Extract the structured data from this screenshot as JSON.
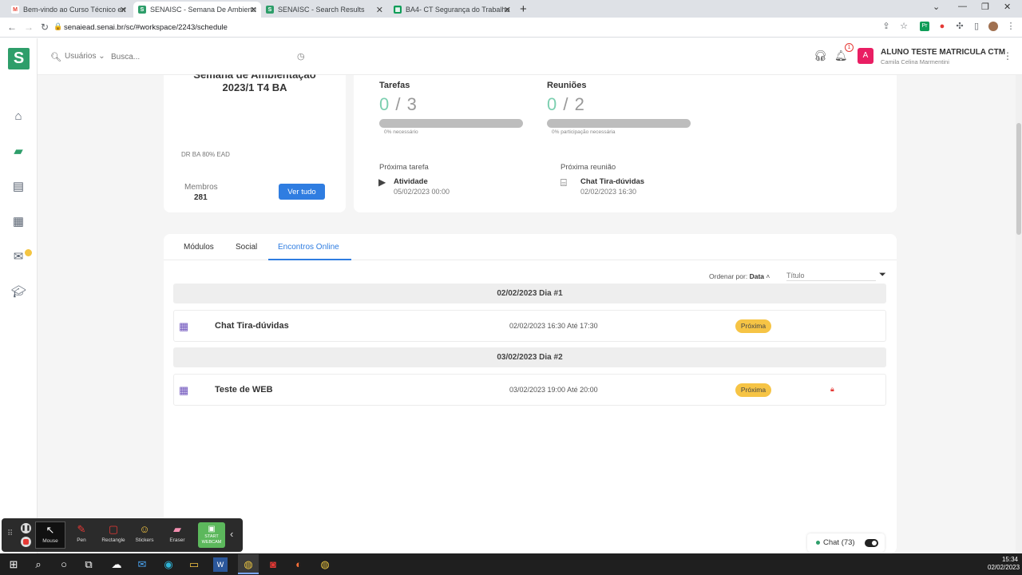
{
  "browser": {
    "tabs": [
      {
        "title": "Bem-vindo ao Curso Técnico em",
        "favicon": "gmail-icon",
        "color": "#ea4335"
      },
      {
        "title": "SENAISC - Semana De Ambienta",
        "favicon": "senai-icon",
        "color": "#2e9e6a"
      },
      {
        "title": "SENAISC - Search Results",
        "favicon": "senai-icon",
        "color": "#2e9e6a"
      },
      {
        "title": "BA4- CT Segurança do Trabalho",
        "favicon": "sheets-icon",
        "color": "#0f9d58"
      }
    ],
    "active_tab": 1,
    "url": "senaiead.senai.br/sc/#workspace/2243/schedule"
  },
  "topbar": {
    "users_dropdown": "Usuários",
    "search_placeholder": "Busca...",
    "notification_count": "1",
    "avatar_letter": "A",
    "user_name": "ALUNO TESTE MATRICULA CTM",
    "user_sub": "Camila Celina Marmentini"
  },
  "course": {
    "title_partial": "Semana de Ambientação",
    "title": "2023/1 T4 BA",
    "code": "DR BA 80% EAD",
    "members_label": "Membros",
    "members_count": "281",
    "view_all": "Ver tudo"
  },
  "stats": {
    "tasks": {
      "label": "Tarefas",
      "done": "0",
      "sep": "/",
      "total": "3",
      "progress_label": "0% necessário",
      "progress": 0
    },
    "meetings": {
      "label": "Reuniões",
      "done": "0",
      "sep": "/",
      "total": "2",
      "progress_label": "0% participação necessária",
      "progress": 0
    },
    "next_task": {
      "label": "Próxima tarefa",
      "title": "Atividade",
      "date": "05/02/2023 00:00"
    },
    "next_meeting": {
      "label": "Próxima reunião",
      "title": "Chat Tira-dúvidas",
      "date": "02/02/2023 16:30"
    }
  },
  "content_tabs": [
    "Módulos",
    "Social",
    "Encontros Online"
  ],
  "selected_tab": "Encontros Online",
  "sort": {
    "label": "Ordenar por:",
    "value": "Data",
    "title_placeholder": "Título"
  },
  "schedule": [
    {
      "day": "02/02/2023 Dia #1",
      "events": [
        {
          "title": "Chat Tira-dúvidas",
          "time": "02/02/2023 16:30 Até 17:30",
          "status": "Próxima",
          "locked": false
        }
      ]
    },
    {
      "day": "03/02/2023 Dia #2",
      "events": [
        {
          "title": "Teste de WEB",
          "time": "03/02/2023 19:00 Até 20:00",
          "status": "Próxima",
          "locked": true
        }
      ]
    }
  ],
  "chat": {
    "label": "Chat (73)",
    "enabled": true
  },
  "recorder": {
    "tools": [
      "Mouse",
      "Pen",
      "Rectangle",
      "Stickers",
      "Eraser"
    ],
    "webcam": "START WEBCAM"
  },
  "taskbar": {
    "time": "15:34",
    "date": "02/02/2023"
  },
  "colors": {
    "brand": "#2e9e6a",
    "accent": "#2f7de1",
    "badge": "#f6c445",
    "calendar_icon": "#6b4fbb"
  }
}
